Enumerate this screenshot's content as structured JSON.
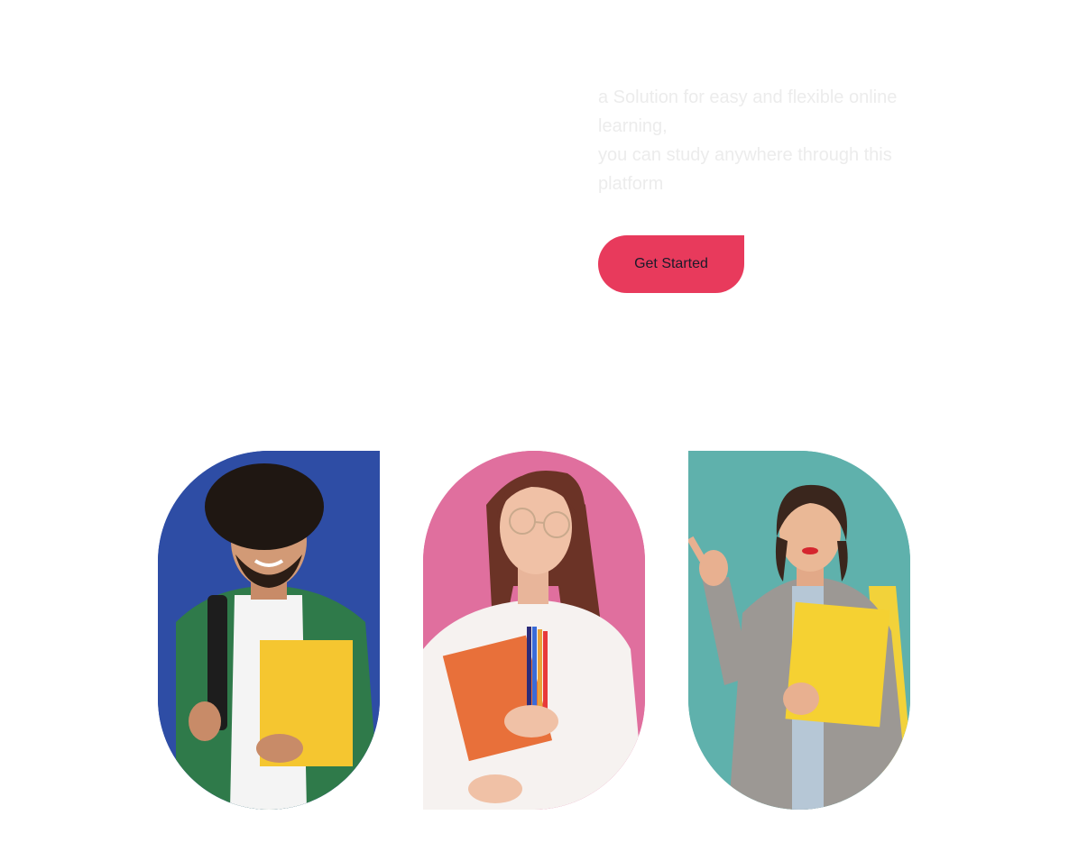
{
  "hero": {
    "line1": "a Solution for easy and flexible online learning,",
    "line2": "you can study anywhere through this platform",
    "cta_label": "Get Started"
  },
  "students": [
    {
      "photo": "student-man-green-shirt",
      "background": "#2e4da5",
      "folder_color": "#f5c630"
    },
    {
      "photo": "student-woman-glasses",
      "background": "#e06f9e",
      "folder_color": "#e8703a"
    },
    {
      "photo": "student-woman-pointing",
      "background": "#5fb1ac",
      "folder_color": "#f5d132"
    }
  ],
  "colors": {
    "accent": "#e83a5c",
    "text_muted": "#ececec"
  }
}
